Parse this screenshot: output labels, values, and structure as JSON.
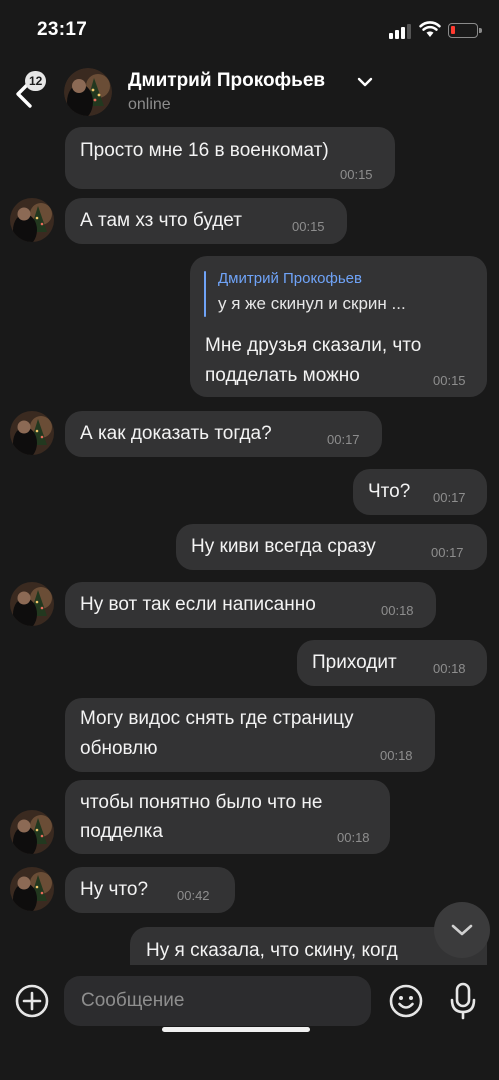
{
  "status_bar": {
    "time": "23:17"
  },
  "header": {
    "unread_count": "12",
    "contact_name": "Дмитрий Прокофьев",
    "status": "online"
  },
  "messages": [
    {
      "direction": "incoming",
      "text": "Просто мне 16 в военкомат)",
      "time": "00:15"
    },
    {
      "direction": "incoming",
      "text": "А там хз что будет",
      "time": "00:15"
    },
    {
      "direction": "outgoing",
      "reply_to_name": "Дмитрий Прокофьев",
      "reply_to_text": "у я же скинул и скрин ...",
      "lines": [
        "Мне друзья сказали, что",
        "подделать можно"
      ],
      "time": "00:15"
    },
    {
      "direction": "incoming",
      "text": "А как доказать тогда?",
      "time": "00:17"
    },
    {
      "direction": "outgoing",
      "text": "Что?",
      "time": "00:17"
    },
    {
      "direction": "outgoing",
      "text": "Ну киви всегда сразу",
      "time": "00:17"
    },
    {
      "direction": "incoming",
      "text": "Ну вот так если написанно",
      "time": "00:18"
    },
    {
      "direction": "outgoing",
      "text": "Приходит",
      "time": "00:18"
    },
    {
      "direction": "incoming",
      "lines": [
        "Могу видос снять где страницу",
        "обновлю"
      ],
      "time": "00:18"
    },
    {
      "direction": "incoming",
      "lines": [
        "чтобы понятно было что не",
        "подделка"
      ],
      "time": "00:18"
    },
    {
      "direction": "incoming",
      "text": "Ну что?",
      "time": "00:42"
    },
    {
      "direction": "outgoing",
      "text": "Ну я сказала, что скину, когд"
    }
  ],
  "composer": {
    "placeholder": "Сообщение"
  },
  "colors": {
    "background": "#191919",
    "bubble": "#333334",
    "accent": "#6fa3f7",
    "battery_low": "#ff3b30"
  },
  "icons": [
    "back-arrow-icon",
    "chevron-down-icon",
    "plus-circle-icon",
    "emoji-icon",
    "microphone-icon",
    "scroll-down-chevron-icon"
  ]
}
